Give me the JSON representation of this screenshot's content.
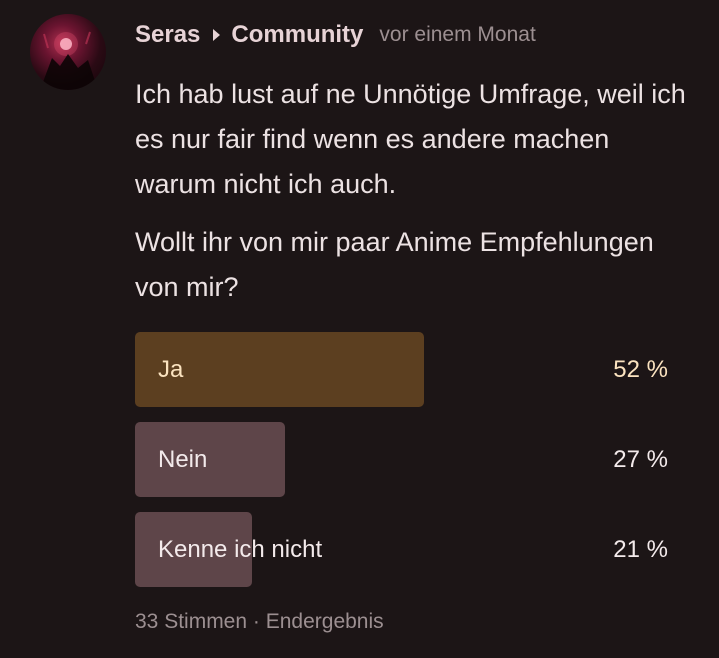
{
  "post": {
    "author": "Seras",
    "community": "Community",
    "time": "vor einem Monat",
    "body": "Ich hab lust auf ne Unnötige Umfrage, weil ich es nur fair find wenn es andere machen warum nicht ich auch.",
    "question": "Wollt ihr von mir paar Anime Empfehlungen von mir?"
  },
  "poll": {
    "options": [
      {
        "label": "Ja",
        "percent_label": "52 %",
        "percent": 52,
        "color": "#5c3f20",
        "winner": true
      },
      {
        "label": "Nein",
        "percent_label": "27 %",
        "percent": 27,
        "color": "#5e4549",
        "winner": false
      },
      {
        "label": "Kenne ich nicht",
        "percent_label": "21 %",
        "percent": 21,
        "color": "#5e4549",
        "winner": false
      }
    ],
    "votes": "33 Stimmen",
    "separator": "·",
    "status": "Endergebnis"
  },
  "icons": {
    "avatar": "user-avatar",
    "chevron": "chevron-right-icon"
  },
  "colors": {
    "background": "#1c1516",
    "text": "#ece2e3",
    "muted": "#9c8f91",
    "winner_text": "#fbe3c0"
  }
}
